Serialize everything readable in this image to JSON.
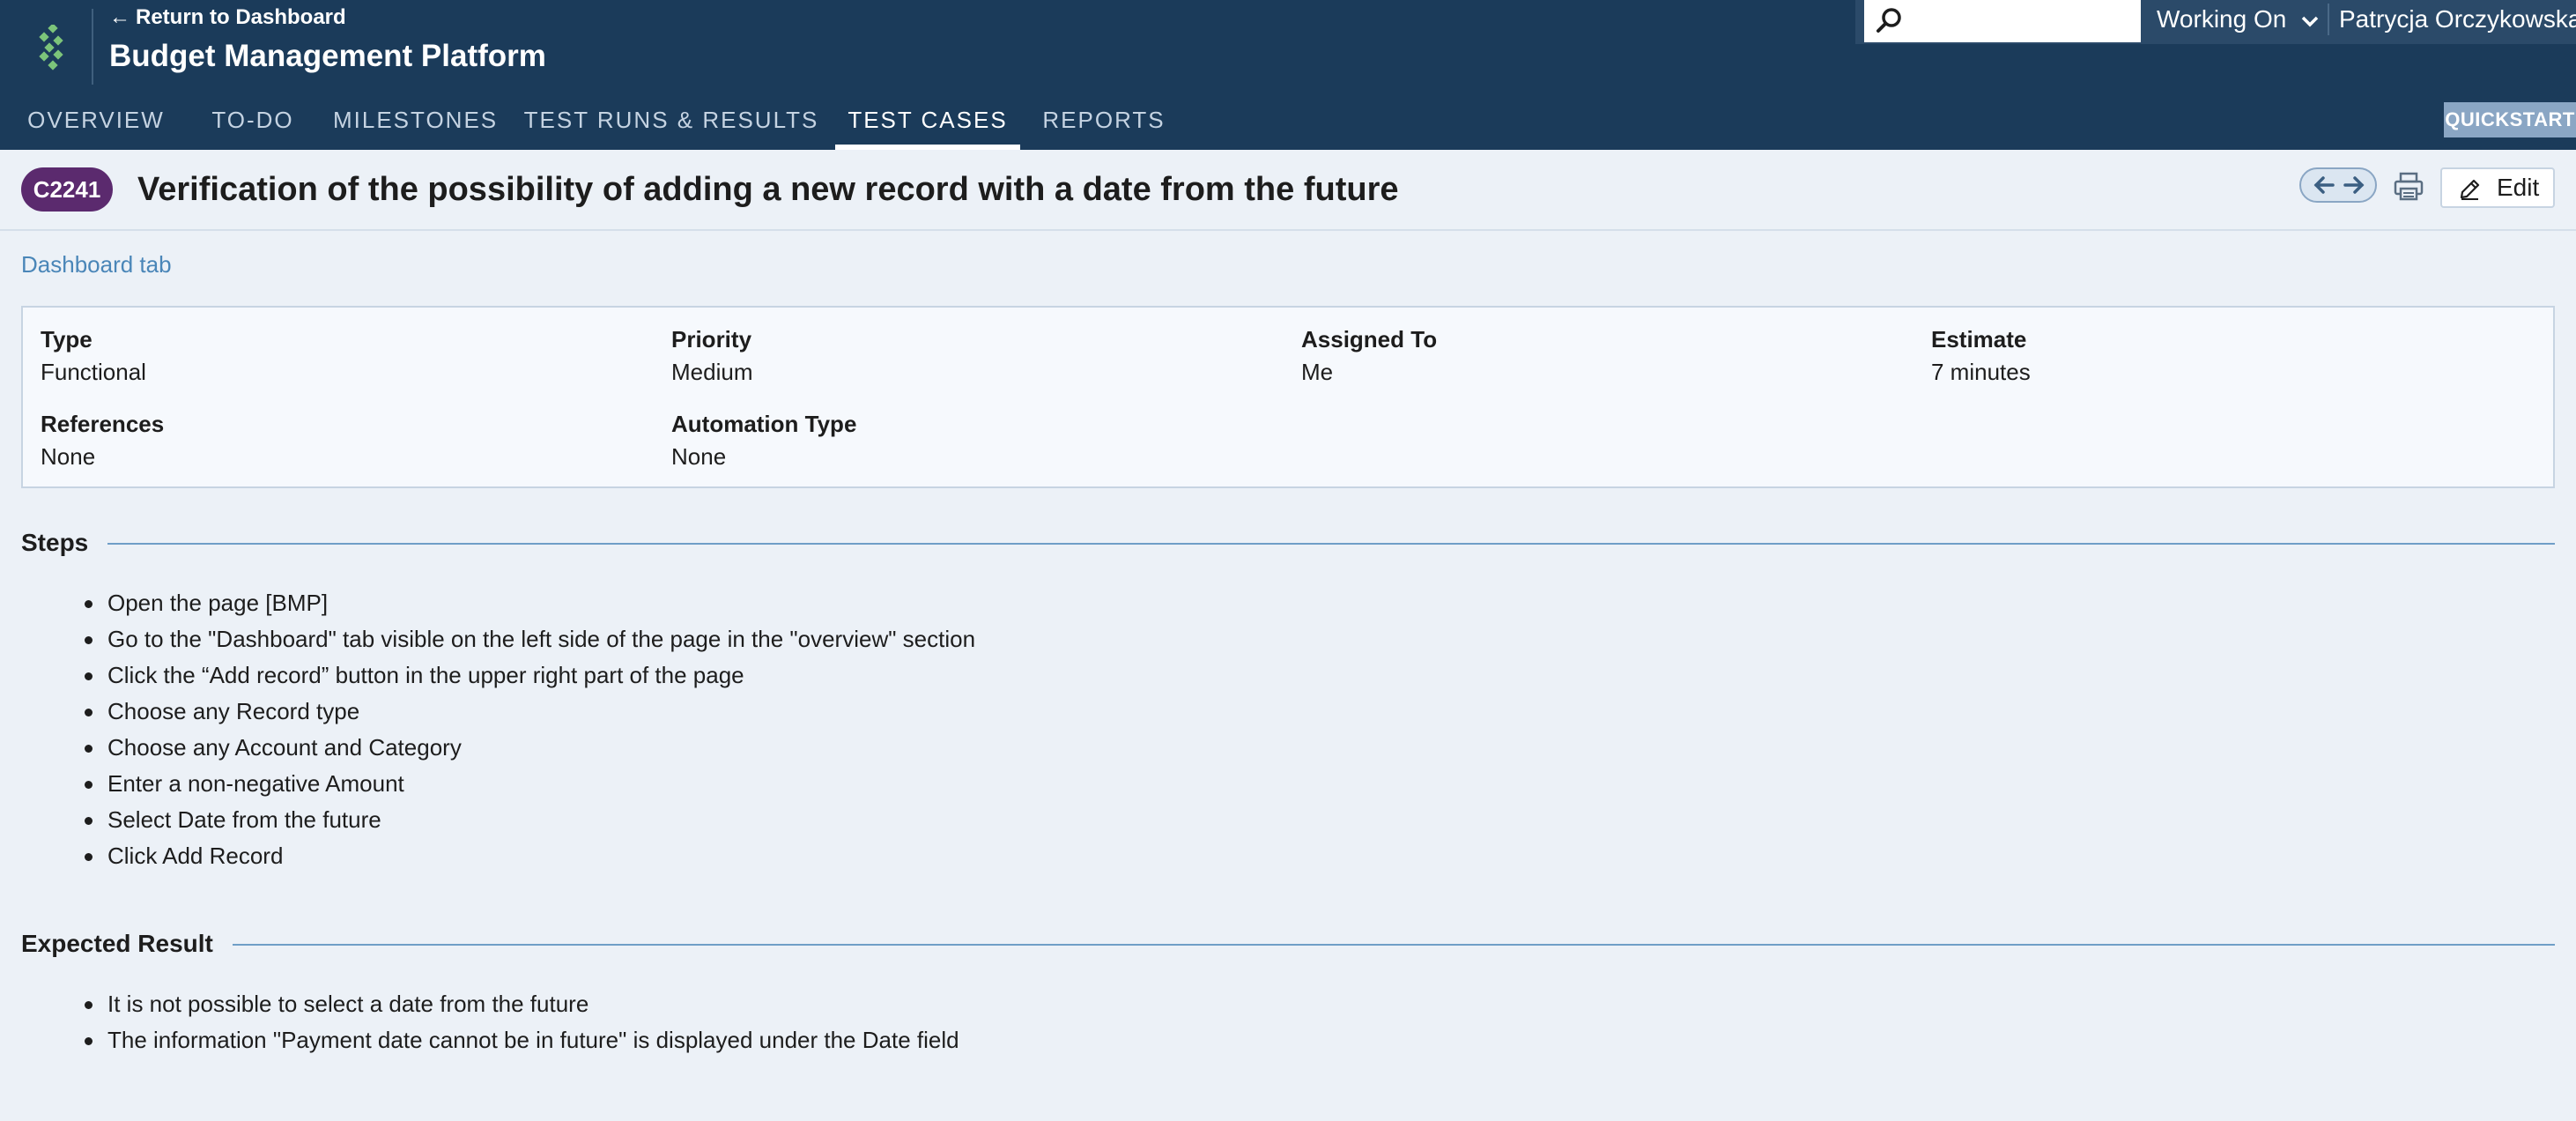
{
  "header": {
    "return_link": "Return to Dashboard",
    "project_title": "Budget Management Platform",
    "search": {
      "placeholder": ""
    },
    "working_on": "Working On",
    "user_name": "Patrycja Orczykowska",
    "quickstart": "QUICKSTART",
    "tabs": [
      {
        "label": "OVERVIEW",
        "active": false
      },
      {
        "label": "TO-DO",
        "active": false
      },
      {
        "label": "MILESTONES",
        "active": false
      },
      {
        "label": "TEST RUNS & RESULTS",
        "active": false
      },
      {
        "label": "TEST CASES",
        "active": true
      },
      {
        "label": "REPORTS",
        "active": false
      }
    ]
  },
  "case": {
    "id": "C2241",
    "title": "Verification of the possibility of adding a new record with a date from the future",
    "edit_label": "Edit",
    "section": "Dashboard tab"
  },
  "properties": {
    "type": {
      "label": "Type",
      "value": "Functional"
    },
    "priority": {
      "label": "Priority",
      "value": "Medium"
    },
    "assigned_to": {
      "label": "Assigned To",
      "value": "Me"
    },
    "estimate": {
      "label": "Estimate",
      "value": "7 minutes"
    },
    "references": {
      "label": "References",
      "value": "None"
    },
    "automation_type": {
      "label": "Automation Type",
      "value": "None"
    }
  },
  "steps": {
    "title": "Steps",
    "items": [
      "Open the page [BMP]",
      "Go to the \"Dashboard\" tab visible on the left side of the page in the \"overview\" section",
      "Click the “Add record” button in the upper right part of the page",
      "Choose any Record type",
      "Choose any Account and Category",
      "Enter a non-negative Amount",
      "Select Date from the future",
      "Click Add Record"
    ]
  },
  "expected": {
    "title": "Expected Result",
    "items": [
      "It is not possible to select a date from the future",
      "The information \"Payment date cannot be in future\" is displayed under the Date field"
    ]
  },
  "colors": {
    "header_bg": "#1b3b5a",
    "badge_bg": "#5b2a6e",
    "link": "#4a86b8",
    "accent_line": "#6f9ec7"
  },
  "icons": [
    "logo-icon",
    "search-icon",
    "chevron-down-icon",
    "arrow-left-icon",
    "arrow-right-icon",
    "print-icon",
    "pencil-icon"
  ]
}
